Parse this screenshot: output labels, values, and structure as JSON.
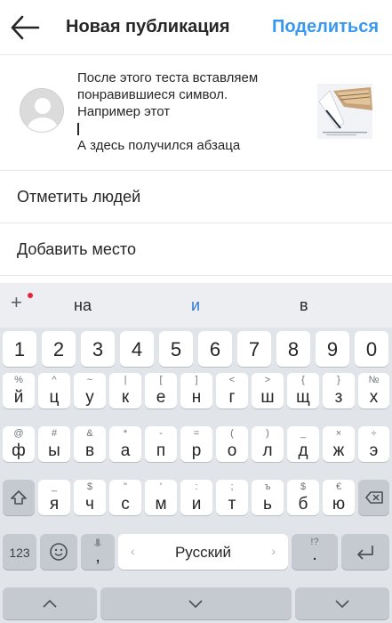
{
  "header": {
    "title": "Новая публикация",
    "share_label": "Поделиться"
  },
  "post": {
    "caption_lines": [
      "После этого теста вставляем",
      "понравившиеся символ.",
      "Например этот",
      "",
      "А здесь получился абзаца"
    ]
  },
  "options": {
    "tag_people": "Отметить людей",
    "add_place": "Добавить место"
  },
  "keyboard": {
    "suggestions": [
      "на",
      "и",
      "в"
    ],
    "number_row": [
      "1",
      "2",
      "3",
      "4",
      "5",
      "6",
      "7",
      "8",
      "9",
      "0"
    ],
    "row1": {
      "main": [
        "й",
        "ц",
        "у",
        "к",
        "е",
        "н",
        "г",
        "ш",
        "щ",
        "з",
        "х"
      ],
      "sub": [
        "%",
        "^",
        "~",
        "|",
        "[",
        "]",
        "<",
        ">",
        "{",
        "}",
        "№"
      ]
    },
    "row2": {
      "main": [
        "ф",
        "ы",
        "в",
        "а",
        "п",
        "р",
        "о",
        "л",
        "д",
        "ж",
        "э"
      ],
      "sub": [
        "@",
        "#",
        "&",
        "*",
        "-",
        "=",
        "(",
        ")",
        "_",
        "×",
        "÷"
      ]
    },
    "row3": {
      "main": [
        "я",
        "ч",
        "с",
        "м",
        "и",
        "т",
        "ь",
        "б",
        "ю"
      ],
      "sub": [
        "_",
        "$",
        "\"",
        "'",
        ":",
        ";",
        "ъ",
        "$",
        "€"
      ]
    },
    "numbers_key": "123",
    "comma_key": ",",
    "space_label": "Русский",
    "period_key": ".",
    "period_sub": "!?"
  },
  "colors": {
    "accent": "#3897f0",
    "suggestion_highlight": "#2d7ad6",
    "keyboard_bg": "#e1e4e9"
  }
}
